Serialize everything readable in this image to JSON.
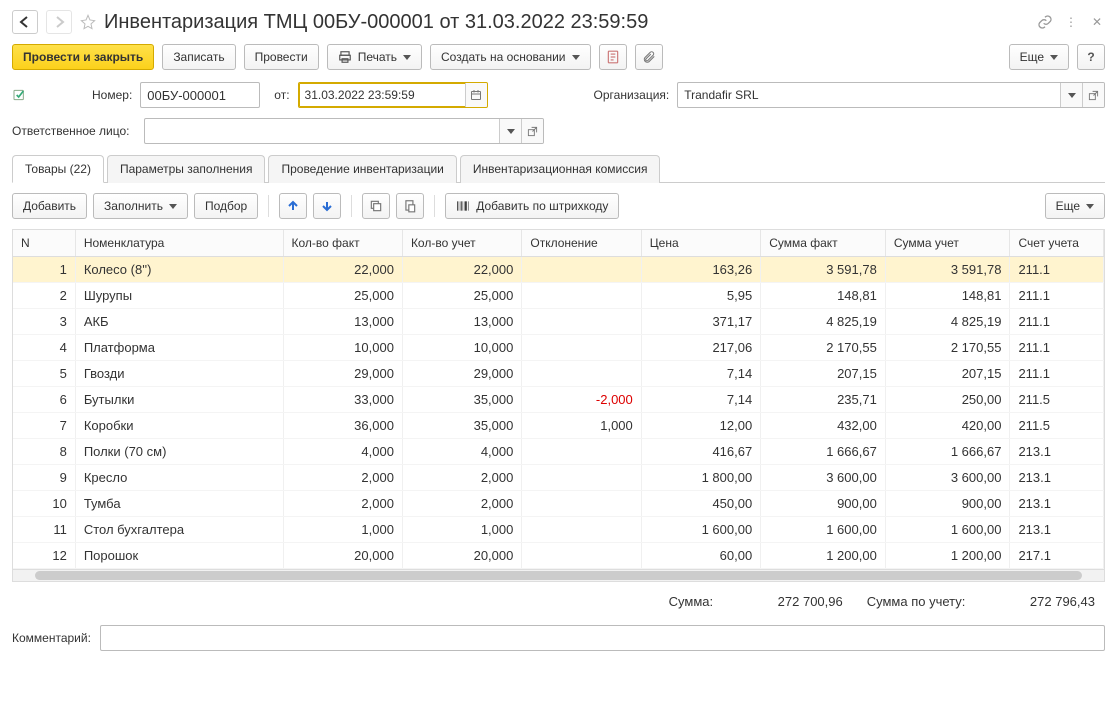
{
  "title": "Инвентаризация ТМЦ 00БУ-000001 от 31.03.2022 23:59:59",
  "toolbar": {
    "post_and_close": "Провести и закрыть",
    "save": "Записать",
    "post": "Провести",
    "print": "Печать",
    "create_based": "Создать на основании",
    "more": "Еще"
  },
  "form": {
    "number_label": "Номер:",
    "number_value": "00БУ-000001",
    "date_label": "от:",
    "date_value": "31.03.2022 23:59:59",
    "org_label": "Организация:",
    "org_value": "Trandafir SRL",
    "responsible_label": "Ответственное лицо:"
  },
  "tabs": [
    {
      "label": "Товары (22)"
    },
    {
      "label": "Параметры заполнения"
    },
    {
      "label": "Проведение инвентаризации"
    },
    {
      "label": "Инвентаризационная комиссия"
    }
  ],
  "tab_toolbar": {
    "add": "Добавить",
    "fill": "Заполнить",
    "select": "Подбор",
    "add_by_barcode": "Добавить по штрихкоду",
    "more": "Еще"
  },
  "columns": [
    "N",
    "Номенклатура",
    "Кол-во факт",
    "Кол-во учет",
    "Отклонение",
    "Цена",
    "Сумма факт",
    "Сумма учет",
    "Счет учета"
  ],
  "rows": [
    {
      "n": "1",
      "name": "Колесо (8'')",
      "qf": "22,000",
      "qa": "22,000",
      "dev": "",
      "price": "163,26",
      "sf": "3 591,78",
      "sa": "3 591,78",
      "acc": "211.1"
    },
    {
      "n": "2",
      "name": "Шурупы",
      "qf": "25,000",
      "qa": "25,000",
      "dev": "",
      "price": "5,95",
      "sf": "148,81",
      "sa": "148,81",
      "acc": "211.1"
    },
    {
      "n": "3",
      "name": "АКБ",
      "qf": "13,000",
      "qa": "13,000",
      "dev": "",
      "price": "371,17",
      "sf": "4 825,19",
      "sa": "4 825,19",
      "acc": "211.1"
    },
    {
      "n": "4",
      "name": "Платформа",
      "qf": "10,000",
      "qa": "10,000",
      "dev": "",
      "price": "217,06",
      "sf": "2 170,55",
      "sa": "2 170,55",
      "acc": "211.1"
    },
    {
      "n": "5",
      "name": "Гвозди",
      "qf": "29,000",
      "qa": "29,000",
      "dev": "",
      "price": "7,14",
      "sf": "207,15",
      "sa": "207,15",
      "acc": "211.1"
    },
    {
      "n": "6",
      "name": "Бутылки",
      "qf": "33,000",
      "qa": "35,000",
      "dev": "-2,000",
      "price": "7,14",
      "sf": "235,71",
      "sa": "250,00",
      "acc": "211.5"
    },
    {
      "n": "7",
      "name": "Коробки",
      "qf": "36,000",
      "qa": "35,000",
      "dev": "1,000",
      "price": "12,00",
      "sf": "432,00",
      "sa": "420,00",
      "acc": "211.5"
    },
    {
      "n": "8",
      "name": "Полки (70 см)",
      "qf": "4,000",
      "qa": "4,000",
      "dev": "",
      "price": "416,67",
      "sf": "1 666,67",
      "sa": "1 666,67",
      "acc": "213.1"
    },
    {
      "n": "9",
      "name": "Кресло",
      "qf": "2,000",
      "qa": "2,000",
      "dev": "",
      "price": "1 800,00",
      "sf": "3 600,00",
      "sa": "3 600,00",
      "acc": "213.1"
    },
    {
      "n": "10",
      "name": "Тумба",
      "qf": "2,000",
      "qa": "2,000",
      "dev": "",
      "price": "450,00",
      "sf": "900,00",
      "sa": "900,00",
      "acc": "213.1"
    },
    {
      "n": "11",
      "name": "Стол бухгалтера",
      "qf": "1,000",
      "qa": "1,000",
      "dev": "",
      "price": "1 600,00",
      "sf": "1 600,00",
      "sa": "1 600,00",
      "acc": "213.1"
    },
    {
      "n": "12",
      "name": "Порошок",
      "qf": "20,000",
      "qa": "20,000",
      "dev": "",
      "price": "60,00",
      "sf": "1 200,00",
      "sa": "1 200,00",
      "acc": "217.1"
    }
  ],
  "totals": {
    "sum_label": "Сумма:",
    "sum_value": "272 700,96",
    "sum_acc_label": "Сумма по учету:",
    "sum_acc_value": "272 796,43"
  },
  "comment_label": "Комментарий:"
}
